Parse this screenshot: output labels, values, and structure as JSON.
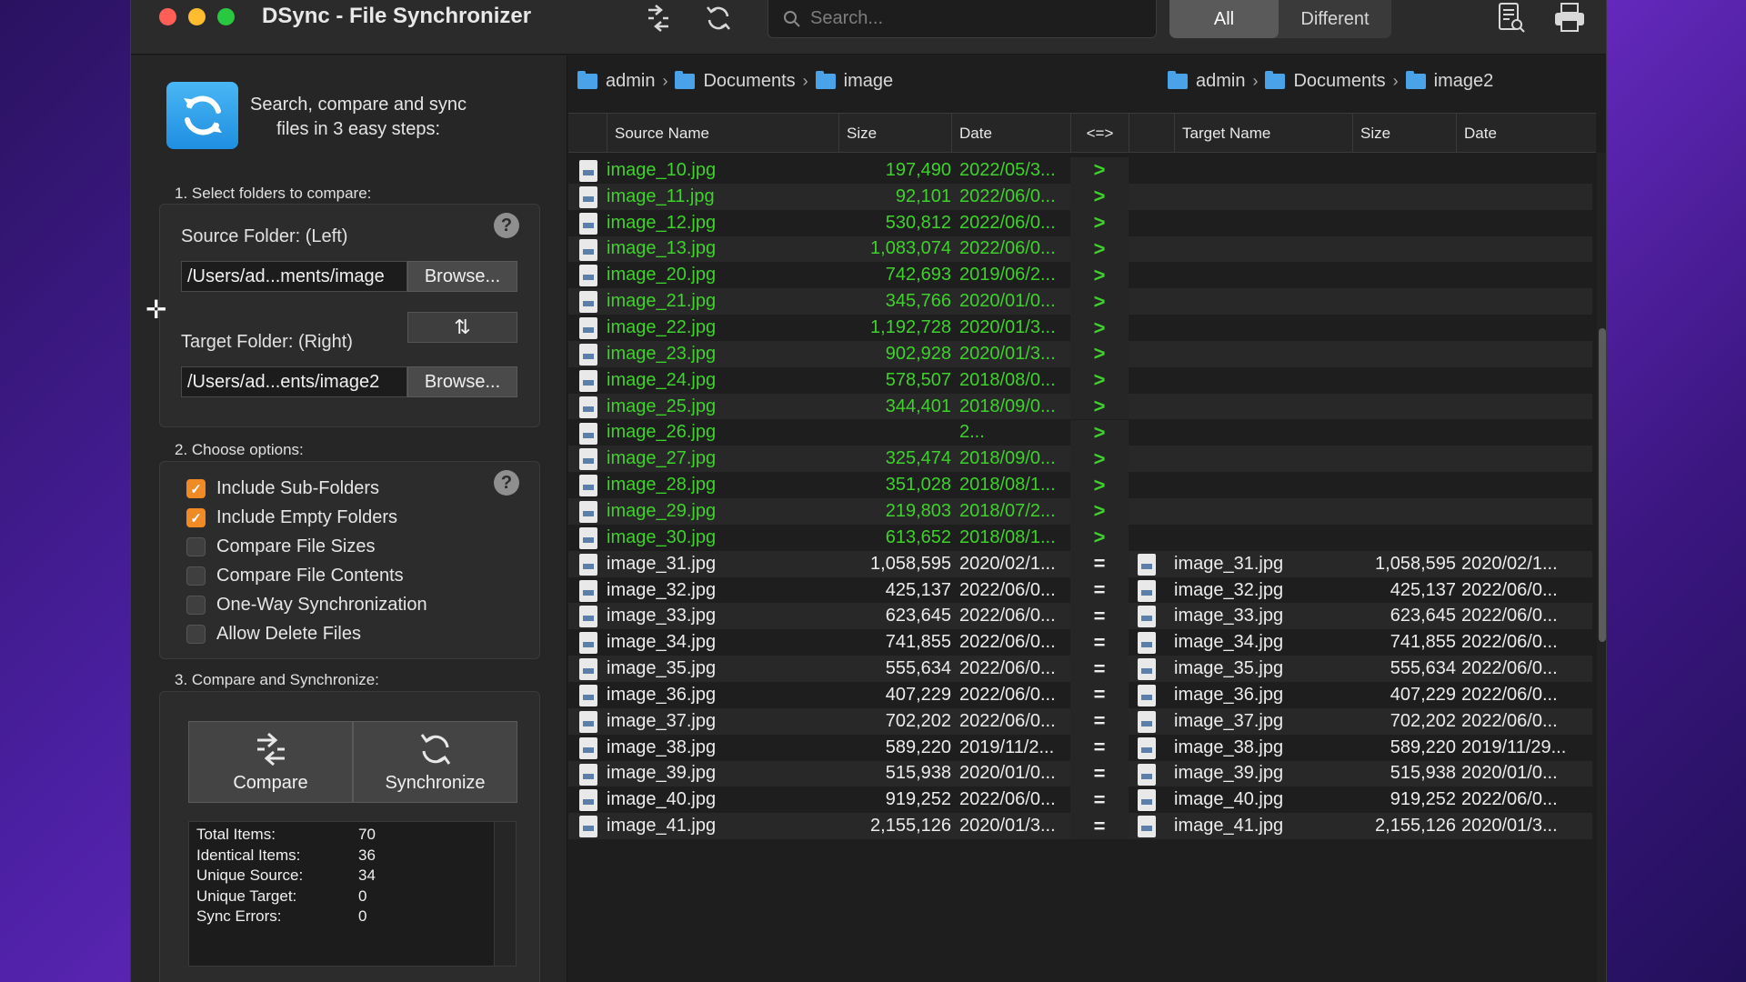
{
  "window": {
    "title": "DSync - File Synchronizer"
  },
  "toolbar": {
    "search_placeholder": "Search...",
    "filter_all": "All",
    "filter_different": "Different"
  },
  "left": {
    "intro": "Search, compare and sync files in 3 easy steps:",
    "step1": "1. Select folders to compare:",
    "source_label": "Source Folder: (Left)",
    "source_path": "/Users/ad...ments/image",
    "target_label": "Target Folder: (Right)",
    "target_path": "/Users/ad...ents/image2",
    "browse": "Browse...",
    "help": "?",
    "step2": "2. Choose options:",
    "options": [
      {
        "label": "Include Sub-Folders",
        "checked": true
      },
      {
        "label": "Include Empty Folders",
        "checked": true
      },
      {
        "label": "Compare File Sizes",
        "checked": false
      },
      {
        "label": "Compare File Contents",
        "checked": false
      },
      {
        "label": "One-Way Synchronization",
        "checked": false
      },
      {
        "label": "Allow Delete Files",
        "checked": false
      }
    ],
    "step3": "3. Compare and Synchronize:",
    "compare_label": "Compare",
    "sync_label": "Synchronize",
    "stats": [
      {
        "k": "Total Items:",
        "v": "70"
      },
      {
        "k": "Identical Items:",
        "v": "36"
      },
      {
        "k": "Unique Source:",
        "v": "34"
      },
      {
        "k": "Unique Target:",
        "v": "0"
      },
      {
        "k": "Sync Errors:",
        "v": "0"
      }
    ]
  },
  "breadcrumbs": {
    "source": [
      "admin",
      "Documents",
      "image"
    ],
    "target": [
      "admin",
      "Documents",
      "image2"
    ]
  },
  "columns": {
    "source_name": "Source Name",
    "size": "Size",
    "date": "Date",
    "cmp": "<=>",
    "target_name": "Target Name",
    "tsize": "Size",
    "tdate": "Date"
  },
  "colors": {
    "unique": "#3fd12c",
    "normal": "#ececec"
  },
  "rows": [
    {
      "src": "image_10.jpg",
      "size": "197,490",
      "date": "2022/05/3...",
      "cmp": ">",
      "tgt": "",
      "tsize": "",
      "tdate": ""
    },
    {
      "src": "image_11.jpg",
      "size": "92,101",
      "date": "2022/06/0...",
      "cmp": ">",
      "tgt": "",
      "tsize": "",
      "tdate": ""
    },
    {
      "src": "image_12.jpg",
      "size": "530,812",
      "date": "2022/06/0...",
      "cmp": ">",
      "tgt": "",
      "tsize": "",
      "tdate": ""
    },
    {
      "src": "image_13.jpg",
      "size": "1,083,074",
      "date": "2022/06/0...",
      "cmp": ">",
      "tgt": "",
      "tsize": "",
      "tdate": ""
    },
    {
      "src": "image_20.jpg",
      "size": "742,693",
      "date": "2019/06/2...",
      "cmp": ">",
      "tgt": "",
      "tsize": "",
      "tdate": ""
    },
    {
      "src": "image_21.jpg",
      "size": "345,766",
      "date": "2020/01/0...",
      "cmp": ">",
      "tgt": "",
      "tsize": "",
      "tdate": ""
    },
    {
      "src": "image_22.jpg",
      "size": "1,192,728",
      "date": "2020/01/3...",
      "cmp": ">",
      "tgt": "",
      "tsize": "",
      "tdate": ""
    },
    {
      "src": "image_23.jpg",
      "size": "902,928",
      "date": "2020/01/3...",
      "cmp": ">",
      "tgt": "",
      "tsize": "",
      "tdate": ""
    },
    {
      "src": "image_24.jpg",
      "size": "578,507",
      "date": "2018/08/0...",
      "cmp": ">",
      "tgt": "",
      "tsize": "",
      "tdate": ""
    },
    {
      "src": "image_25.jpg",
      "size": "344,401",
      "date": "2018/09/0...",
      "cmp": ">",
      "tgt": "",
      "tsize": "",
      "tdate": ""
    },
    {
      "src": "image_26.jpg",
      "size": "",
      "date": "2...",
      "cmp": ">",
      "tgt": "",
      "tsize": "",
      "tdate": ""
    },
    {
      "src": "image_27.jpg",
      "size": "325,474",
      "date": "2018/09/0...",
      "cmp": ">",
      "tgt": "",
      "tsize": "",
      "tdate": ""
    },
    {
      "src": "image_28.jpg",
      "size": "351,028",
      "date": "2018/08/1...",
      "cmp": ">",
      "tgt": "",
      "tsize": "",
      "tdate": ""
    },
    {
      "src": "image_29.jpg",
      "size": "219,803",
      "date": "2018/07/2...",
      "cmp": ">",
      "tgt": "",
      "tsize": "",
      "tdate": ""
    },
    {
      "src": "image_30.jpg",
      "size": "613,652",
      "date": "2018/08/1...",
      "cmp": ">",
      "tgt": "",
      "tsize": "",
      "tdate": ""
    },
    {
      "src": "image_31.jpg",
      "size": "1,058,595",
      "date": "2020/02/1...",
      "cmp": "=",
      "tgt": "image_31.jpg",
      "tsize": "1,058,595",
      "tdate": "2020/02/1..."
    },
    {
      "src": "image_32.jpg",
      "size": "425,137",
      "date": "2022/06/0...",
      "cmp": "=",
      "tgt": "image_32.jpg",
      "tsize": "425,137",
      "tdate": "2022/06/0..."
    },
    {
      "src": "image_33.jpg",
      "size": "623,645",
      "date": "2022/06/0...",
      "cmp": "=",
      "tgt": "image_33.jpg",
      "tsize": "623,645",
      "tdate": "2022/06/0..."
    },
    {
      "src": "image_34.jpg",
      "size": "741,855",
      "date": "2022/06/0...",
      "cmp": "=",
      "tgt": "image_34.jpg",
      "tsize": "741,855",
      "tdate": "2022/06/0..."
    },
    {
      "src": "image_35.jpg",
      "size": "555,634",
      "date": "2022/06/0...",
      "cmp": "=",
      "tgt": "image_35.jpg",
      "tsize": "555,634",
      "tdate": "2022/06/0..."
    },
    {
      "src": "image_36.jpg",
      "size": "407,229",
      "date": "2022/06/0...",
      "cmp": "=",
      "tgt": "image_36.jpg",
      "tsize": "407,229",
      "tdate": "2022/06/0..."
    },
    {
      "src": "image_37.jpg",
      "size": "702,202",
      "date": "2022/06/0...",
      "cmp": "=",
      "tgt": "image_37.jpg",
      "tsize": "702,202",
      "tdate": "2022/06/0..."
    },
    {
      "src": "image_38.jpg",
      "size": "589,220",
      "date": "2019/11/2...",
      "cmp": "=",
      "tgt": "image_38.jpg",
      "tsize": "589,220",
      "tdate": "2019/11/29..."
    },
    {
      "src": "image_39.jpg",
      "size": "515,938",
      "date": "2020/01/0...",
      "cmp": "=",
      "tgt": "image_39.jpg",
      "tsize": "515,938",
      "tdate": "2020/01/0..."
    },
    {
      "src": "image_40.jpg",
      "size": "919,252",
      "date": "2022/06/0...",
      "cmp": "=",
      "tgt": "image_40.jpg",
      "tsize": "919,252",
      "tdate": "2022/06/0..."
    },
    {
      "src": "image_41.jpg",
      "size": "2,155,126",
      "date": "2020/01/3...",
      "cmp": "=",
      "tgt": "image_41.jpg",
      "tsize": "2,155,126",
      "tdate": "2020/01/3..."
    }
  ]
}
